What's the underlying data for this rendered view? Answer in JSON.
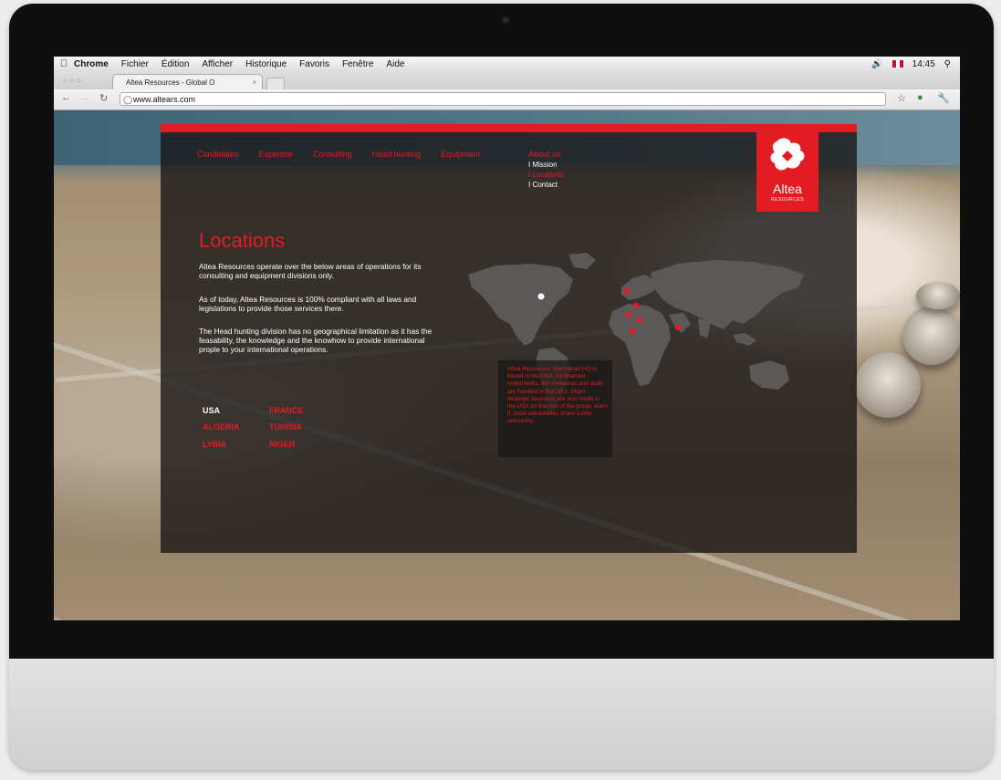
{
  "menubar": {
    "app": "Chrome",
    "items": [
      "Fichier",
      "Édition",
      "Afficher",
      "Historique",
      "Favoris",
      "Fenêtre",
      "Aide"
    ],
    "time": "14:45"
  },
  "browser": {
    "tab_title": "Altea Resources - Global O",
    "tab_close": "×",
    "url": "www.altears.com"
  },
  "site": {
    "nav": [
      "Candidates",
      "Expertise",
      "Consulting",
      "Head hunting",
      "Equipment"
    ],
    "about": {
      "label": "About us",
      "subitems": [
        "I Mission",
        "I Locations",
        "I Contact"
      ]
    },
    "logo": {
      "name": "Altea",
      "tagline": "RESOURCES"
    },
    "title": "Locations",
    "paragraphs": [
      "Altea Resources operate over the below areas of operations for its consulting and equipment divisions only.",
      "As of today, Altea Resources is 100% compliant with all laws and legislations to provide those services there.",
      "The Head hunting division has no  geographical limitation as it  has the feasability, the knowledge and the knowhow to provide international prople to your international operations."
    ],
    "countries": [
      "USA",
      "FRANCE",
      "ALGERIA",
      "TUNISIA",
      "LYBIA",
      "NIGER"
    ],
    "active_country": "USA",
    "callout": "Altea Resources' Manhattan HQ is based in the USA. All financial movements, risk measures and audit are handled in the USA. Major strategic decisions are also made in the USA for the rest of the group, even if, most subsidiaries share a little autonomy."
  },
  "colors": {
    "brand_red": "#e31c23",
    "panel": "#191716"
  },
  "icons": [
    "apple-icon",
    "volume-icon",
    "flag-icon",
    "spotlight-icon",
    "back-icon",
    "forward-icon",
    "reload-icon",
    "globe-icon",
    "star-icon",
    "extension-icon",
    "wrench-icon"
  ]
}
